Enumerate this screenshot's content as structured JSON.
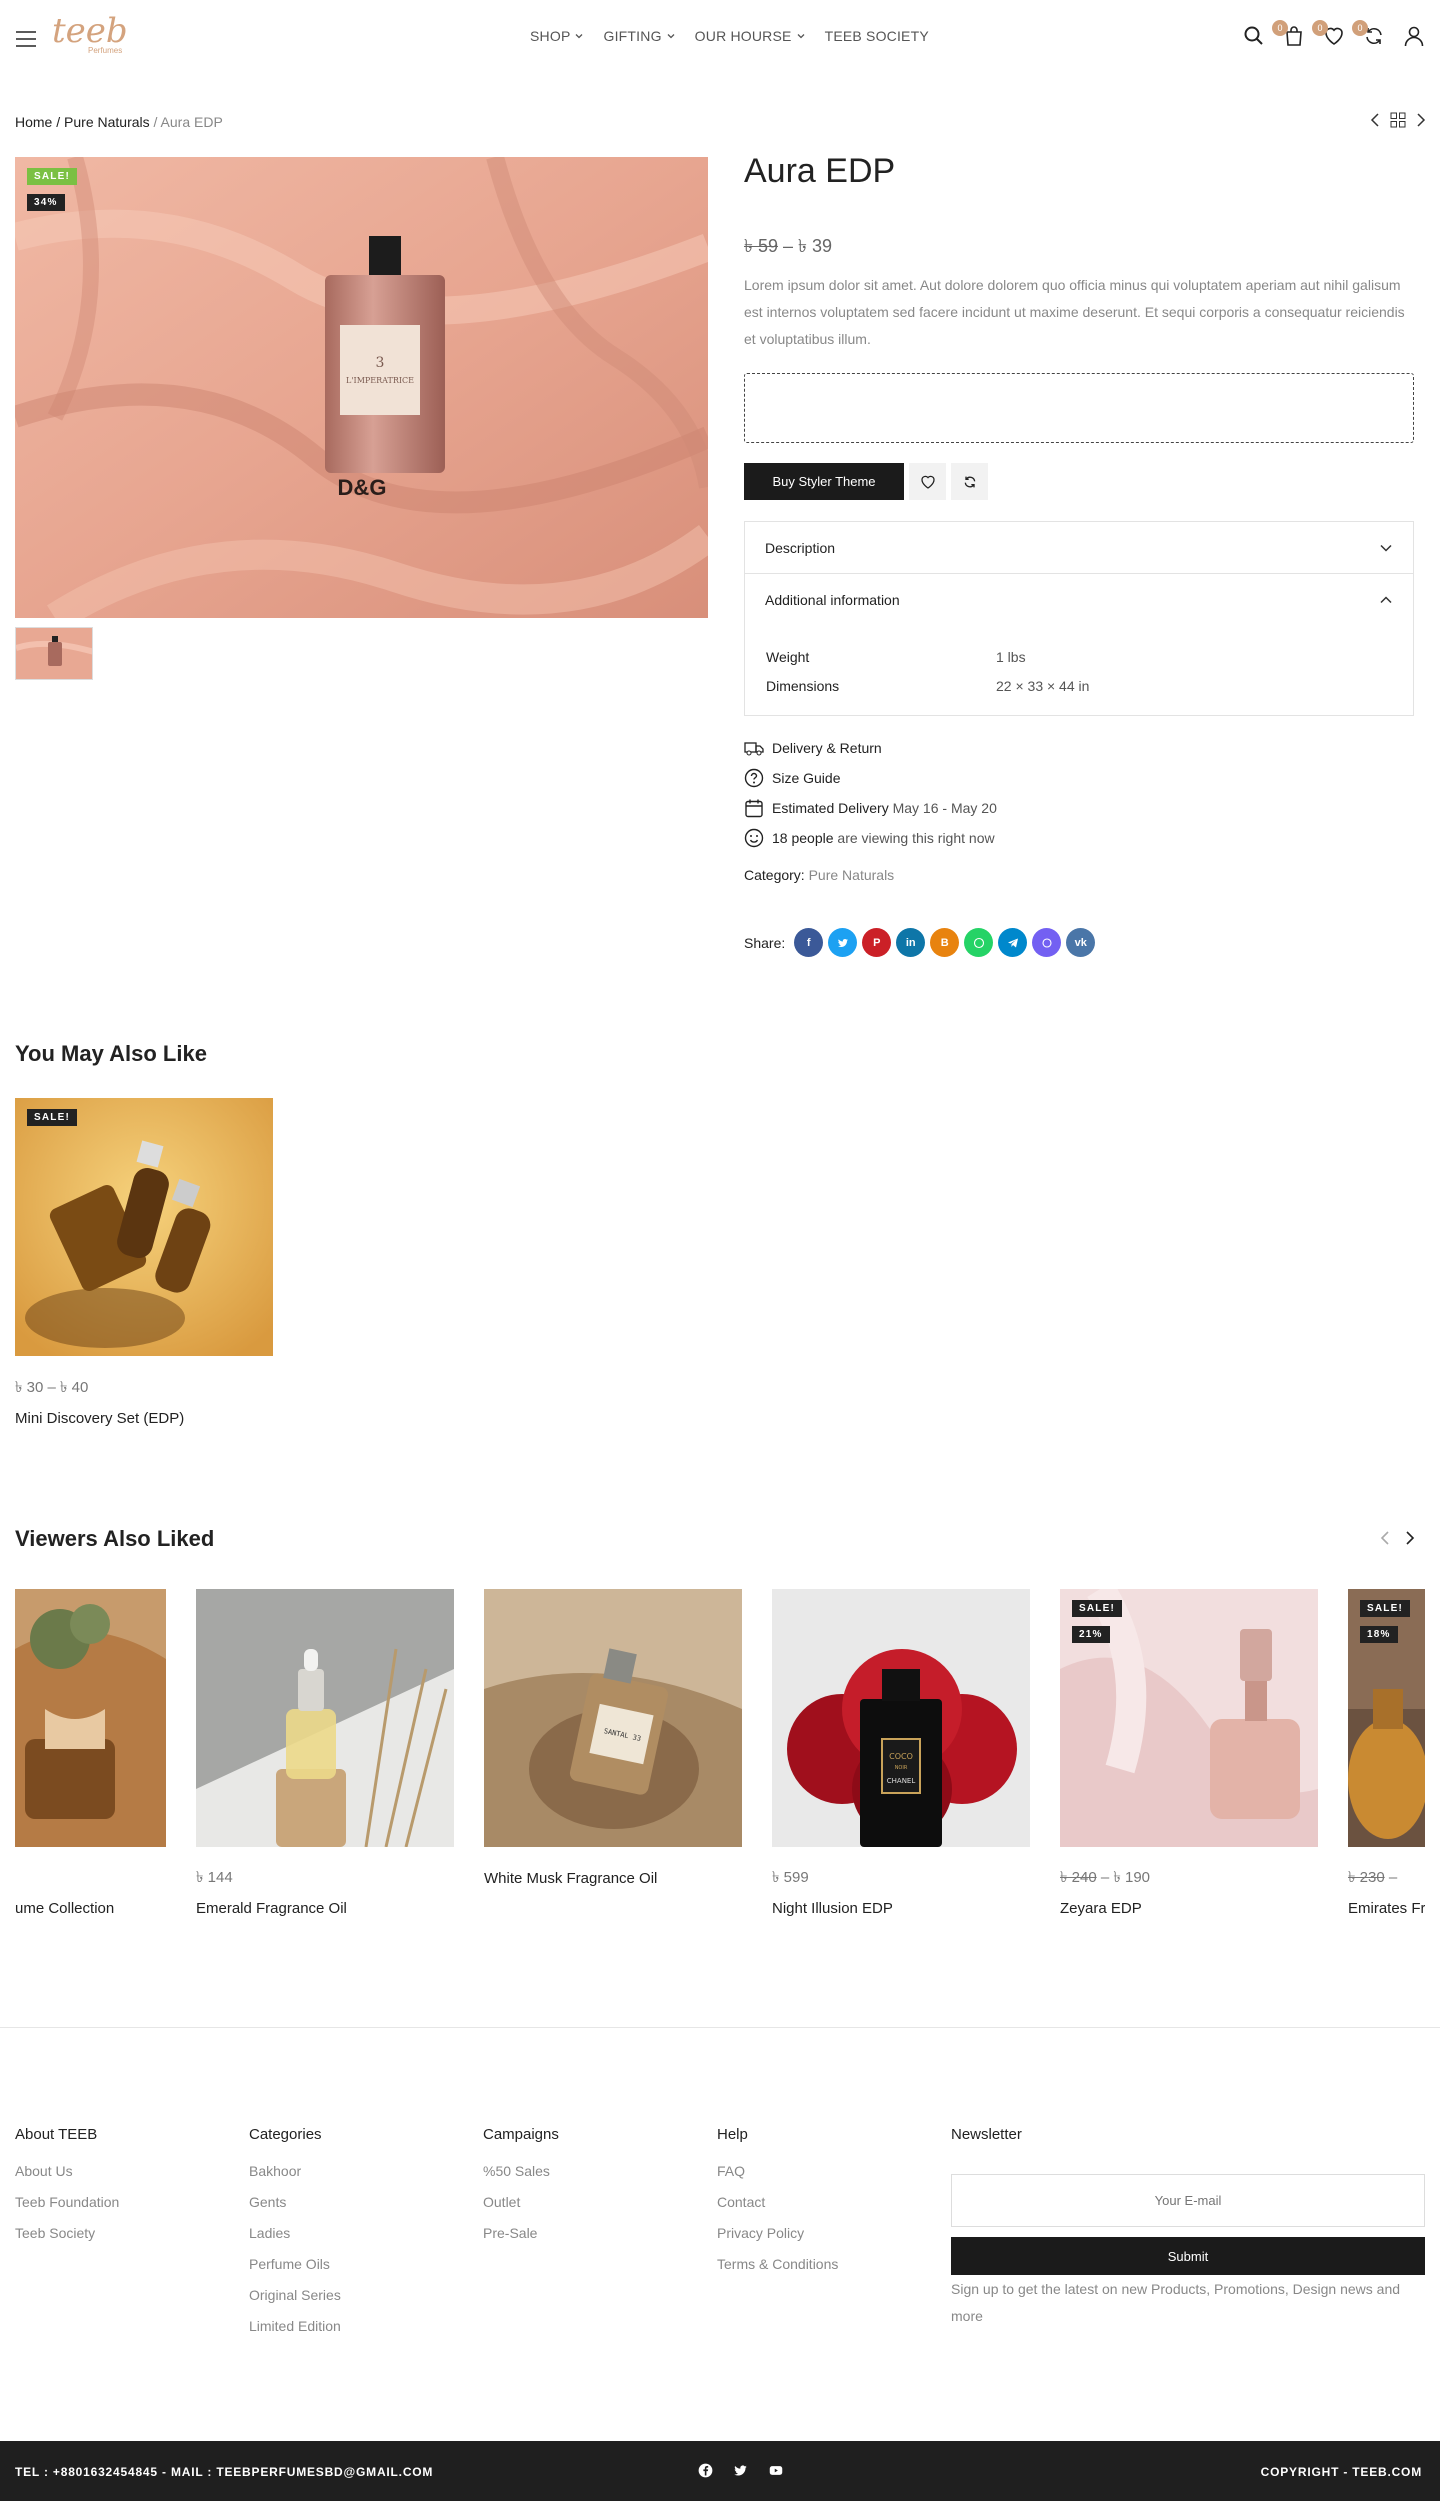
{
  "header": {
    "logo_text": "teeb",
    "logo_sub": "Perfumes",
    "nav": [
      {
        "label": "SHOP"
      },
      {
        "label": "GIFTING"
      },
      {
        "label": "OUR HOURSE"
      },
      {
        "label": "TEEB SOCIETY"
      }
    ],
    "cart_count": "0",
    "wishlist_count": "0",
    "compare_count": "0"
  },
  "breadcrumb": {
    "home": "Home",
    "sep1": "/",
    "category": "Pure Naturals",
    "sep2": "/",
    "current": "Aura EDP"
  },
  "product": {
    "sale_badge": "SALE!",
    "discount_badge": "34%",
    "bottle_label_num": "3",
    "bottle_label_name": "L'IMPERATRICE",
    "bottle_brand": "D&G",
    "title": "Aura EDP",
    "price_old": "৳ 59",
    "price_sep": "–",
    "price_new": "৳ 39",
    "description": "Lorem ipsum dolor sit amet. Aut dolore dolorem quo officia minus qui voluptatem aperiam aut nihil galisum est internos voluptatem sed facere incidunt ut maxime deserunt. Et sequi corporis a consequatur reiciendis et voluptatibus illum.",
    "buy_label": "Buy Styler Theme",
    "accordion": {
      "description_label": "Description",
      "additional_label": "Additional information",
      "rows": [
        {
          "key": "Weight",
          "value": "1 lbs"
        },
        {
          "key": "Dimensions",
          "value": "22 × 33 × 44 in"
        }
      ]
    },
    "meta": {
      "delivery": "Delivery & Return",
      "size_guide": "Size Guide",
      "estimated_label": "Estimated Delivery",
      "estimated_value": "May 16 - May 20",
      "viewing_count": "18 people",
      "viewing_text": "are viewing this right now"
    },
    "category_label": "Category:",
    "category_value": "Pure Naturals",
    "share_label": "Share:",
    "share_colors": [
      "#3b5998",
      "#1da1f2",
      "#cb2027",
      "#0e76a8",
      "#e8830f",
      "#25d366",
      "#0088cc",
      "#7360f2",
      "#4a76a8"
    ]
  },
  "related": {
    "title": "You May Also Like",
    "items": [
      {
        "badge": "SALE!",
        "price": "৳ 30 – ৳ 40",
        "name": "Mini Discovery Set (EDP)"
      }
    ]
  },
  "viewers": {
    "title": "Viewers Also Liked",
    "items": [
      {
        "name": "ume Collection",
        "price": ""
      },
      {
        "name": "Emerald Fragrance Oil",
        "price": "৳ 144"
      },
      {
        "name": "White Musk Fragrance Oil",
        "price": ""
      },
      {
        "name": "Night Illusion EDP",
        "price": "৳ 599"
      },
      {
        "name": "Zeyara EDP",
        "price_old": "৳ 240",
        "price_sep": "–",
        "price": "৳ 190",
        "badge": "SALE!",
        "discount": "21%"
      },
      {
        "name": "Emirates Fr",
        "price_old": "৳ 230",
        "price_sep": "–",
        "badge": "SALE!",
        "discount": "18%"
      }
    ],
    "bottle_texts": {
      "chanel_top": "COCO",
      "chanel_mid": "NOIR",
      "chanel_brand": "CHANEL",
      "lelabo": "SANTAL 33"
    }
  },
  "footer": {
    "cols": [
      {
        "title": "About TEEB",
        "links": [
          "About Us",
          "Teeb Foundation",
          "Teeb Society"
        ]
      },
      {
        "title": "Categories",
        "links": [
          "Bakhoor",
          "Gents",
          "Ladies",
          "Perfume Oils",
          "Original Series",
          "Limited Edition"
        ]
      },
      {
        "title": "Campaigns",
        "links": [
          "%50 Sales",
          "Outlet",
          "Pre-Sale"
        ]
      },
      {
        "title": "Help",
        "links": [
          "FAQ",
          "Contact",
          "Privacy Policy",
          "Terms & Conditions"
        ]
      }
    ],
    "newsletter": {
      "title": "Newsletter",
      "placeholder": "Your E-mail",
      "submit": "Submit",
      "note": "Sign up to get the latest on new Products, Promotions, Design news and more"
    },
    "contact": "TEL : +8801632454845 - MAIL : TEEBPERFUMESBD@GMAIL.COM",
    "copyright": "COPYRIGHT - TEEB.COM"
  }
}
